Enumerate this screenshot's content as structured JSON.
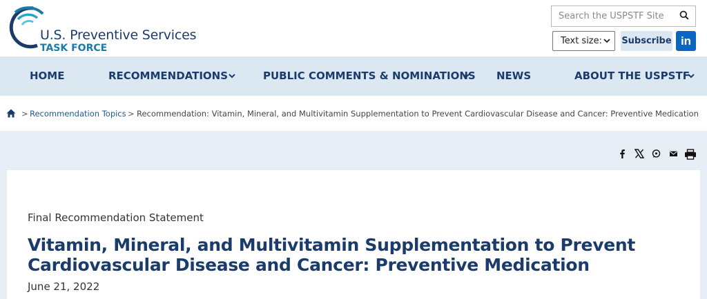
{
  "header": {
    "logo_title": "U.S. Preventive Services",
    "logo_sub": "TASK FORCE",
    "search_placeholder": "Search the USPSTF Site",
    "text_size_label": "Text size:",
    "subscribe_label": "Subscribe",
    "linkedin_label": "in"
  },
  "nav": {
    "items": [
      {
        "label": "HOME",
        "has_dropdown": false
      },
      {
        "label": "RECOMMENDATIONS",
        "has_dropdown": true
      },
      {
        "label": "PUBLIC COMMENTS & NOMINATIONS",
        "has_dropdown": true
      },
      {
        "label": "NEWS",
        "has_dropdown": false
      },
      {
        "label": "ABOUT THE USPSTF",
        "has_dropdown": true
      }
    ]
  },
  "breadcrumb": {
    "separator": ">",
    "link": "Recommendation Topics",
    "current": "Recommendation: Vitamin, Mineral, and Multivitamin Supplementation to Prevent Cardiovascular Disease and Cancer: Preventive Medication"
  },
  "share_icons": [
    "facebook-icon",
    "x-icon",
    "whatsapp-icon",
    "email-icon",
    "print-icon"
  ],
  "article": {
    "eyebrow": "Final Recommendation Statement",
    "title": "Vitamin, Mineral, and Multivitamin Supplementation to Prevent Cardiovascular Disease and Cancer: Preventive Medication",
    "date": "June 21, 2022"
  },
  "colors": {
    "navy": "#1b3c6b",
    "nav_bg": "#dbe7f1",
    "page_bg": "#e6edf4",
    "teal": "#1b7aa6",
    "linkedin": "#0a66c2"
  }
}
